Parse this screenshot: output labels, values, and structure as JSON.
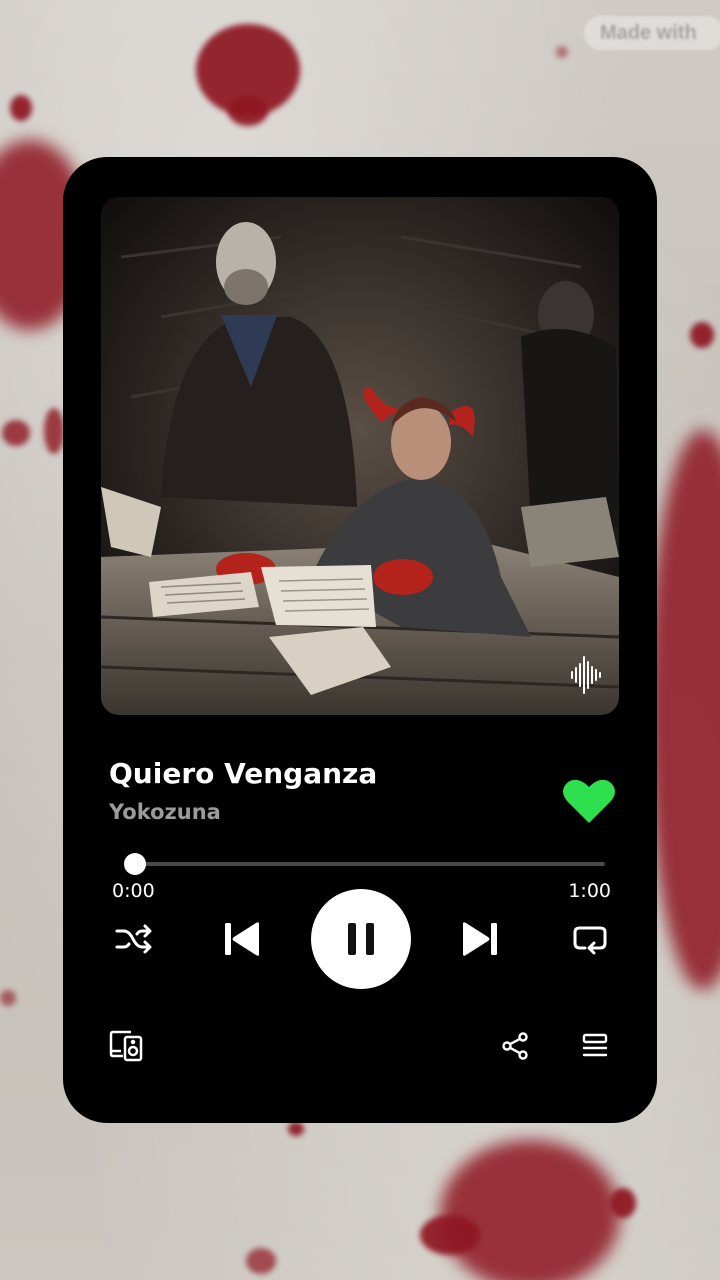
{
  "background": {
    "watermark_text": "Made with",
    "paper_color": "#c9c4bd",
    "blood_color": "#8e1621"
  },
  "player": {
    "card_color": "#000000",
    "album_art_icon": "waveform-icon",
    "track": {
      "title": "Quiero Venganza",
      "artist": "Yokozuna",
      "liked": true
    },
    "accent_color": "#2fe04e",
    "progress": {
      "elapsed": "0:00",
      "total": "1:00",
      "fraction": 0.02
    },
    "controls": {
      "shuffle_icon": "shuffle-icon",
      "previous_icon": "skip-previous-icon",
      "play_state": "playing",
      "play_pause_icon": "pause-icon",
      "next_icon": "skip-next-icon",
      "repeat_icon": "repeat-icon"
    },
    "footer": {
      "devices_icon": "connect-devices-icon",
      "share_icon": "share-icon",
      "queue_icon": "queue-icon"
    }
  }
}
